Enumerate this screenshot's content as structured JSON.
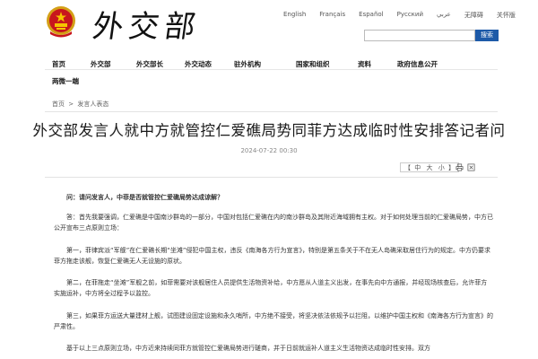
{
  "header": {
    "logo_text": "外交部",
    "languages": [
      "English",
      "Français",
      "Español",
      "Русский",
      "عربي",
      "无障碍",
      "关怀版"
    ],
    "search_button": "搜索",
    "search_placeholder": ""
  },
  "nav": {
    "row1": [
      "首页",
      "外交部",
      "外交部长",
      "外交动态",
      "驻外机构",
      "国家和组织",
      "资料",
      "政府信息公开"
    ],
    "row2": [
      "两微一端"
    ]
  },
  "breadcrumb": {
    "home": "首页",
    "sep": ">",
    "current": "发言人表态"
  },
  "article": {
    "title": "外交部发言人就中方就管控仁爱礁局势同菲方达成临时性安排答记者问",
    "date": "2024-07-22 00:30",
    "font_bracket_open": "【",
    "font_large": "中",
    "font_medium": "大",
    "font_small": "小",
    "font_bracket_close": "】",
    "question": "问：请问发言人，中菲是否就管控仁爱礁局势达成谅解？",
    "paragraphs": [
      "答：首先我要强调，仁爱礁是中国南沙群岛的一部分，中国对包括仁爱礁在内的南沙群岛及其附近海域拥有主权。对于如何处理当前的仁爱礁局势，中方已公开宣布三点原则立场：",
      "第一，菲律宾派“军舰”在仁爱礁长期“坐滩”侵犯中国主权，违反《南海各方行为宣言》，特别是第五条关于不在无人岛礁采取居住行为的规定。中方仍要求菲方拖走该舰，恢复仁爱礁无人无设施的原状。",
      "第二，在菲拖走“坐滩”军舰之前，如菲需要对该舰居住人员提供生活物资补给，中方愿从人道主义出发，在事先向中方通报，并经现场核查后，允许菲方实施运补，中方将全过程予以监控。",
      "第三，如果菲方运送大量建材上舰，试图建设固定设施和永久哨所，中方绝不接受，将坚决依法依规予以拦阻，以维护中国主权和《南海各方行为宣言》的严肃性。",
      "基于以上三点原则立场，中方近来持续同菲方就管控仁爱礁局势进行磋商，并于日前就运补人道主义生活物资达成临时性安排。双方"
    ]
  }
}
